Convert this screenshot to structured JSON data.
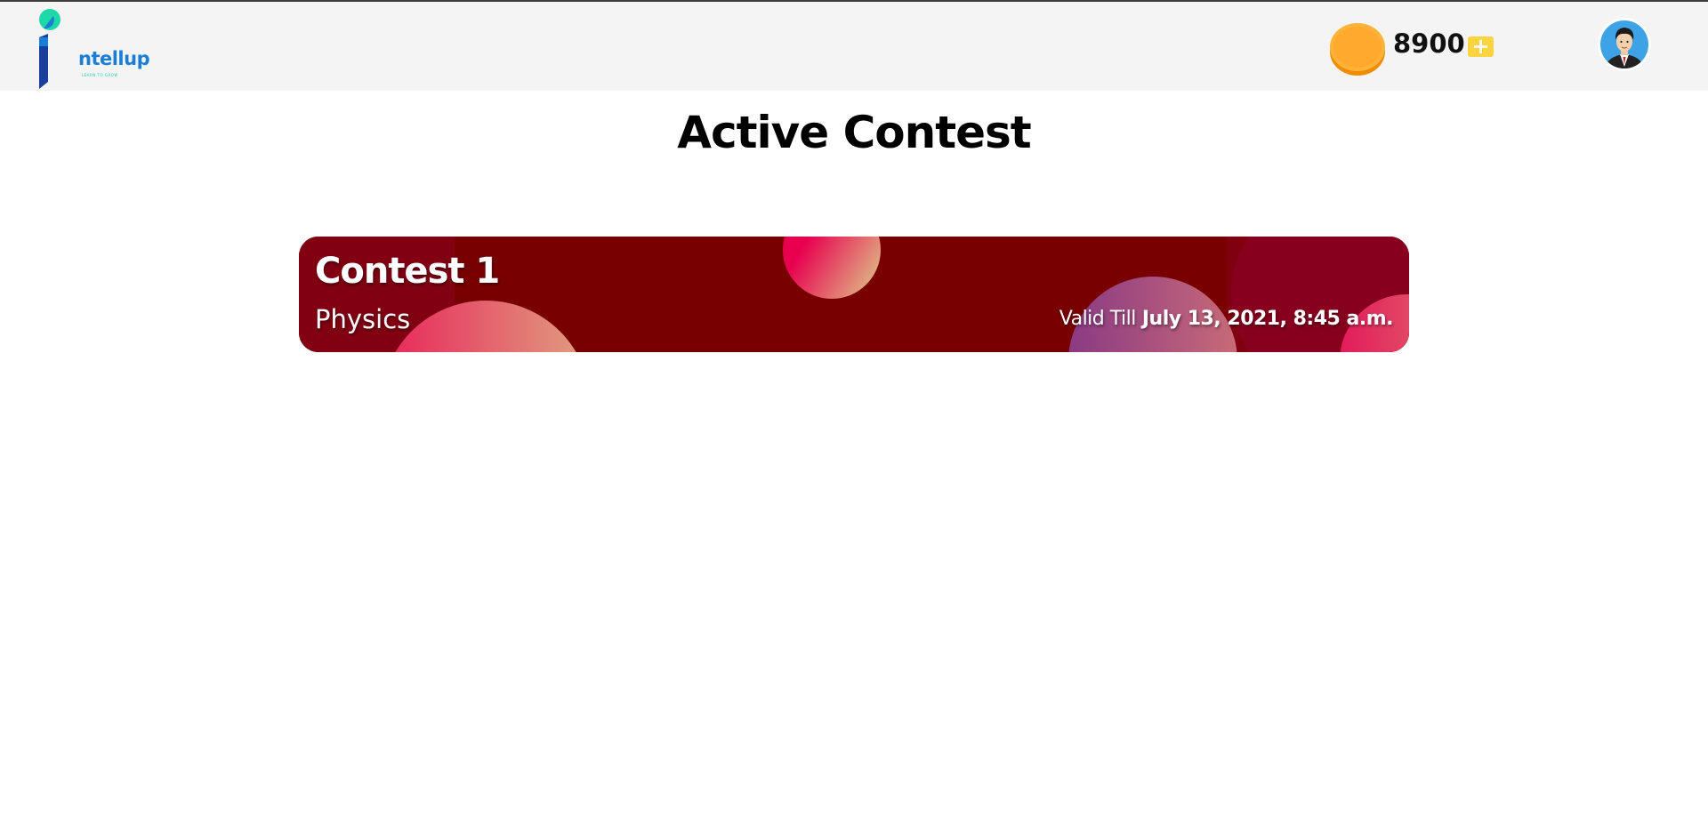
{
  "header": {
    "logo": {
      "text": "ntellup",
      "tagline": "LEARN TO GROW"
    },
    "coins": {
      "value": "8900",
      "add_label": "+"
    },
    "avatar": {
      "icon": "user-avatar-icon"
    }
  },
  "main": {
    "title": "Active Contest",
    "contests": [
      {
        "name": "Contest 1",
        "subject": "Physics",
        "valid_label": "Valid Till",
        "valid_date": "July 13, 2021, 8:45 a.m."
      }
    ]
  },
  "colors": {
    "header_bg": "#f4f4f4",
    "card_bg": "#790000",
    "accent_blue": "#1a7fd4",
    "coin": "#f9a825",
    "plus": "#fcd43f"
  }
}
